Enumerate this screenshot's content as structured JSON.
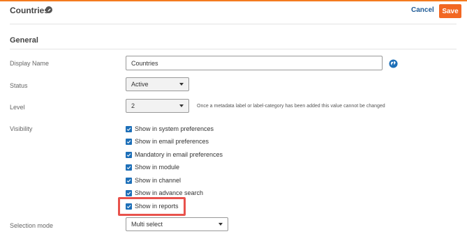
{
  "header": {
    "title": "Countries",
    "cancel_label": "Cancel",
    "save_label": "Save"
  },
  "section": {
    "title": "General"
  },
  "fields": {
    "display_name": {
      "label": "Display Name",
      "value": "Countries"
    },
    "status": {
      "label": "Status",
      "value": "Active"
    },
    "level": {
      "label": "Level",
      "value": "2",
      "note": "Once a metadata label or label-category has been added this value cannot be changed"
    },
    "visibility": {
      "label": "Visibility",
      "options": [
        {
          "label": "Show in system preferences",
          "checked": true
        },
        {
          "label": "Show in email preferences",
          "checked": true
        },
        {
          "label": "Mandatory in email preferences",
          "checked": true
        },
        {
          "label": "Show in module",
          "checked": true
        },
        {
          "label": "Show in channel",
          "checked": true
        },
        {
          "label": "Show in advance search",
          "checked": true
        },
        {
          "label": "Show in reports",
          "checked": true
        }
      ]
    },
    "selection_mode": {
      "label": "Selection mode",
      "value": "Multi select"
    }
  },
  "colors": {
    "accent": "#f26722",
    "link": "#1d5a96",
    "checkbox": "#1d6fb8",
    "highlight": "#e8524c"
  }
}
